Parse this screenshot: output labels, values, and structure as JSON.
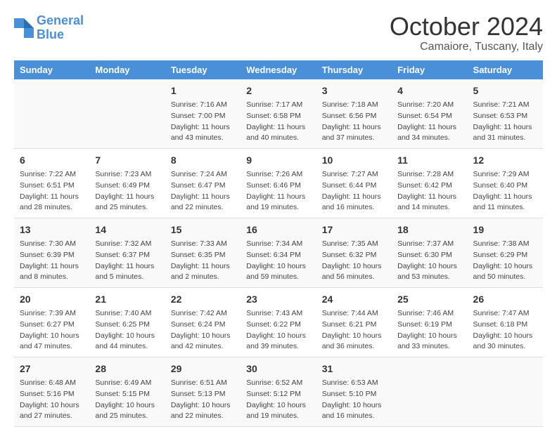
{
  "header": {
    "logo_line1": "General",
    "logo_line2": "Blue",
    "month": "October 2024",
    "location": "Camaiore, Tuscany, Italy"
  },
  "days_of_week": [
    "Sunday",
    "Monday",
    "Tuesday",
    "Wednesday",
    "Thursday",
    "Friday",
    "Saturday"
  ],
  "weeks": [
    [
      {
        "day": "",
        "info": ""
      },
      {
        "day": "",
        "info": ""
      },
      {
        "day": "1",
        "info": "Sunrise: 7:16 AM\nSunset: 7:00 PM\nDaylight: 11 hours and 43 minutes."
      },
      {
        "day": "2",
        "info": "Sunrise: 7:17 AM\nSunset: 6:58 PM\nDaylight: 11 hours and 40 minutes."
      },
      {
        "day": "3",
        "info": "Sunrise: 7:18 AM\nSunset: 6:56 PM\nDaylight: 11 hours and 37 minutes."
      },
      {
        "day": "4",
        "info": "Sunrise: 7:20 AM\nSunset: 6:54 PM\nDaylight: 11 hours and 34 minutes."
      },
      {
        "day": "5",
        "info": "Sunrise: 7:21 AM\nSunset: 6:53 PM\nDaylight: 11 hours and 31 minutes."
      }
    ],
    [
      {
        "day": "6",
        "info": "Sunrise: 7:22 AM\nSunset: 6:51 PM\nDaylight: 11 hours and 28 minutes."
      },
      {
        "day": "7",
        "info": "Sunrise: 7:23 AM\nSunset: 6:49 PM\nDaylight: 11 hours and 25 minutes."
      },
      {
        "day": "8",
        "info": "Sunrise: 7:24 AM\nSunset: 6:47 PM\nDaylight: 11 hours and 22 minutes."
      },
      {
        "day": "9",
        "info": "Sunrise: 7:26 AM\nSunset: 6:46 PM\nDaylight: 11 hours and 19 minutes."
      },
      {
        "day": "10",
        "info": "Sunrise: 7:27 AM\nSunset: 6:44 PM\nDaylight: 11 hours and 16 minutes."
      },
      {
        "day": "11",
        "info": "Sunrise: 7:28 AM\nSunset: 6:42 PM\nDaylight: 11 hours and 14 minutes."
      },
      {
        "day": "12",
        "info": "Sunrise: 7:29 AM\nSunset: 6:40 PM\nDaylight: 11 hours and 11 minutes."
      }
    ],
    [
      {
        "day": "13",
        "info": "Sunrise: 7:30 AM\nSunset: 6:39 PM\nDaylight: 11 hours and 8 minutes."
      },
      {
        "day": "14",
        "info": "Sunrise: 7:32 AM\nSunset: 6:37 PM\nDaylight: 11 hours and 5 minutes."
      },
      {
        "day": "15",
        "info": "Sunrise: 7:33 AM\nSunset: 6:35 PM\nDaylight: 11 hours and 2 minutes."
      },
      {
        "day": "16",
        "info": "Sunrise: 7:34 AM\nSunset: 6:34 PM\nDaylight: 10 hours and 59 minutes."
      },
      {
        "day": "17",
        "info": "Sunrise: 7:35 AM\nSunset: 6:32 PM\nDaylight: 10 hours and 56 minutes."
      },
      {
        "day": "18",
        "info": "Sunrise: 7:37 AM\nSunset: 6:30 PM\nDaylight: 10 hours and 53 minutes."
      },
      {
        "day": "19",
        "info": "Sunrise: 7:38 AM\nSunset: 6:29 PM\nDaylight: 10 hours and 50 minutes."
      }
    ],
    [
      {
        "day": "20",
        "info": "Sunrise: 7:39 AM\nSunset: 6:27 PM\nDaylight: 10 hours and 47 minutes."
      },
      {
        "day": "21",
        "info": "Sunrise: 7:40 AM\nSunset: 6:25 PM\nDaylight: 10 hours and 44 minutes."
      },
      {
        "day": "22",
        "info": "Sunrise: 7:42 AM\nSunset: 6:24 PM\nDaylight: 10 hours and 42 minutes."
      },
      {
        "day": "23",
        "info": "Sunrise: 7:43 AM\nSunset: 6:22 PM\nDaylight: 10 hours and 39 minutes."
      },
      {
        "day": "24",
        "info": "Sunrise: 7:44 AM\nSunset: 6:21 PM\nDaylight: 10 hours and 36 minutes."
      },
      {
        "day": "25",
        "info": "Sunrise: 7:46 AM\nSunset: 6:19 PM\nDaylight: 10 hours and 33 minutes."
      },
      {
        "day": "26",
        "info": "Sunrise: 7:47 AM\nSunset: 6:18 PM\nDaylight: 10 hours and 30 minutes."
      }
    ],
    [
      {
        "day": "27",
        "info": "Sunrise: 6:48 AM\nSunset: 5:16 PM\nDaylight: 10 hours and 27 minutes."
      },
      {
        "day": "28",
        "info": "Sunrise: 6:49 AM\nSunset: 5:15 PM\nDaylight: 10 hours and 25 minutes."
      },
      {
        "day": "29",
        "info": "Sunrise: 6:51 AM\nSunset: 5:13 PM\nDaylight: 10 hours and 22 minutes."
      },
      {
        "day": "30",
        "info": "Sunrise: 6:52 AM\nSunset: 5:12 PM\nDaylight: 10 hours and 19 minutes."
      },
      {
        "day": "31",
        "info": "Sunrise: 6:53 AM\nSunset: 5:10 PM\nDaylight: 10 hours and 16 minutes."
      },
      {
        "day": "",
        "info": ""
      },
      {
        "day": "",
        "info": ""
      }
    ]
  ]
}
